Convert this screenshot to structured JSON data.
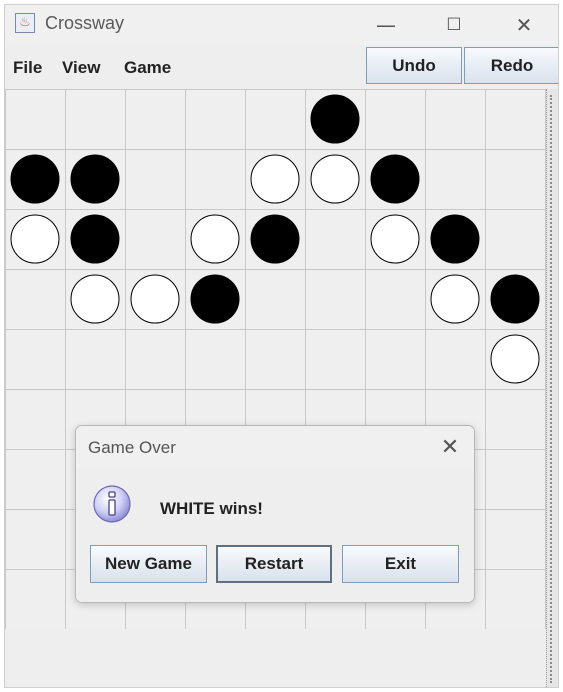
{
  "window": {
    "title": "Crossway",
    "app_icon": "java-cup-icon"
  },
  "controls": {
    "minimize": "—",
    "maximize": "☐",
    "close": "✕"
  },
  "menubar": {
    "menus": [
      "File",
      "View",
      "Game"
    ],
    "undo_label": "Undo",
    "redo_label": "Redo"
  },
  "board": {
    "cols": 9,
    "visible_rows": 9,
    "colors": {
      "black": "#000000",
      "white": "#ffffff",
      "grid": "#c8c8c8",
      "background": "#efefef"
    },
    "stones": [
      {
        "row": 0,
        "col": 5,
        "color": "black"
      },
      {
        "row": 1,
        "col": 0,
        "color": "black"
      },
      {
        "row": 1,
        "col": 1,
        "color": "black"
      },
      {
        "row": 1,
        "col": 4,
        "color": "white"
      },
      {
        "row": 1,
        "col": 5,
        "color": "white"
      },
      {
        "row": 1,
        "col": 6,
        "color": "black"
      },
      {
        "row": 2,
        "col": 0,
        "color": "white"
      },
      {
        "row": 2,
        "col": 1,
        "color": "black"
      },
      {
        "row": 2,
        "col": 3,
        "color": "white"
      },
      {
        "row": 2,
        "col": 4,
        "color": "black"
      },
      {
        "row": 2,
        "col": 6,
        "color": "white"
      },
      {
        "row": 2,
        "col": 7,
        "color": "black"
      },
      {
        "row": 3,
        "col": 1,
        "color": "white"
      },
      {
        "row": 3,
        "col": 2,
        "color": "white"
      },
      {
        "row": 3,
        "col": 3,
        "color": "black"
      },
      {
        "row": 3,
        "col": 7,
        "color": "white"
      },
      {
        "row": 3,
        "col": 8,
        "color": "black"
      },
      {
        "row": 4,
        "col": 8,
        "color": "white"
      }
    ]
  },
  "dialog": {
    "title": "Game Over",
    "close": "✕",
    "icon": "info-icon",
    "message": "WHITE wins!",
    "buttons": {
      "new_game": "New Game",
      "restart": "Restart",
      "exit": "Exit"
    }
  }
}
